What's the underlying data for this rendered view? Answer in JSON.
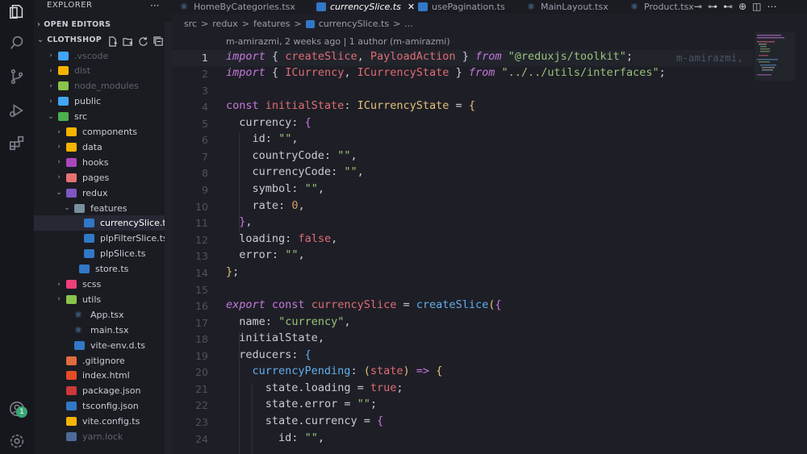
{
  "explorer": {
    "title": "EXPLORER",
    "more": "···",
    "open_editors": "OPEN EDITORS",
    "project": "CLOTHSHOP",
    "items": [
      {
        "label": ".vscode",
        "dim": true
      },
      {
        "label": "dist",
        "dim": true
      },
      {
        "label": "node_modules",
        "dim": true
      },
      {
        "label": "public"
      },
      {
        "label": "src"
      },
      {
        "label": "components"
      },
      {
        "label": "data"
      },
      {
        "label": "hooks"
      },
      {
        "label": "pages"
      },
      {
        "label": "redux"
      },
      {
        "label": "features"
      },
      {
        "label": "currencySlice.ts"
      },
      {
        "label": "plpFilterSlice.ts"
      },
      {
        "label": "plpSlice.ts"
      },
      {
        "label": "store.ts"
      },
      {
        "label": "scss"
      },
      {
        "label": "utils"
      },
      {
        "label": "App.tsx"
      },
      {
        "label": "main.tsx"
      },
      {
        "label": "vite-env.d.ts"
      },
      {
        "label": ".gitignore"
      },
      {
        "label": "index.html"
      },
      {
        "label": "package.json"
      },
      {
        "label": "tsconfig.json"
      },
      {
        "label": "vite.config.ts"
      },
      {
        "label": "yarn.lock",
        "dim": true
      }
    ]
  },
  "activity_badge": "1",
  "tabs": [
    {
      "label": "HomeByCategories.tsx"
    },
    {
      "label": "currencySlice.ts",
      "active": true,
      "close": "✕"
    },
    {
      "label": "usePagination.ts"
    },
    {
      "label": "MainLayout.tsx"
    },
    {
      "label": "Product.tsx"
    }
  ],
  "breadcrumb": {
    "parts": [
      "src",
      "redux",
      "features",
      "currencySlice.ts",
      "..."
    ],
    "sep": ">"
  },
  "blame": {
    "top": "m-amirazmi, 2 weeks ago | 1 author (m-amirazmi)",
    "inline": "m-amirazmi,"
  },
  "code": {
    "line_numbers": [
      "1",
      "2",
      "3",
      "4",
      "5",
      "6",
      "7",
      "8",
      "9",
      "10",
      "11",
      "12",
      "13",
      "14",
      "15",
      "16",
      "17",
      "18",
      "19",
      "20",
      "21",
      "22",
      "23",
      "24"
    ],
    "s1": "\"@reduxjs/toolkit\"",
    "s2": "\"../../utils/interfaces\"",
    "t_currency": "\"currency\""
  },
  "colors": {
    "accent": "#61afef",
    "keyword": "#c678dd",
    "string": "#98c379",
    "variable": "#e06c75",
    "type": "#e5c07b"
  }
}
